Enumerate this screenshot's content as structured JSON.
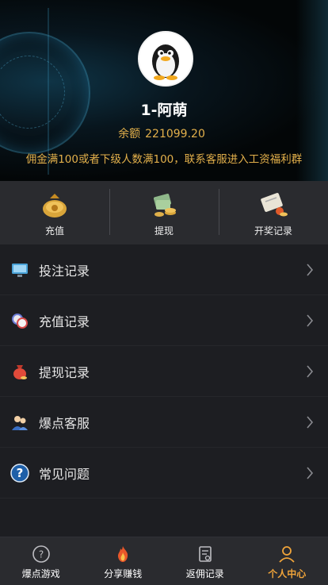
{
  "profile": {
    "username": "1-阿萌",
    "balance_label": "余额",
    "balance_value": "221099.20",
    "notice": "佣金满100或者下级人数满100，联系客服进入工资福利群"
  },
  "quick_actions": [
    {
      "label": "充值",
      "icon": "money-bag-icon"
    },
    {
      "label": "提现",
      "icon": "cash-coins-icon"
    },
    {
      "label": "开奖记录",
      "icon": "lottery-ticket-icon"
    }
  ],
  "menu": [
    {
      "label": "投注记录",
      "icon": "monitor-icon"
    },
    {
      "label": "充值记录",
      "icon": "poker-chips-icon"
    },
    {
      "label": "提现记录",
      "icon": "red-bag-icon"
    },
    {
      "label": "爆点客服",
      "icon": "support-agent-icon"
    },
    {
      "label": "常见问题",
      "icon": "question-icon"
    }
  ],
  "tabs": [
    {
      "label": "爆点游戏",
      "icon": "question-circle-icon",
      "active": false
    },
    {
      "label": "分享赚钱",
      "icon": "flame-icon",
      "active": false
    },
    {
      "label": "返佣记录",
      "icon": "receipt-icon",
      "active": false
    },
    {
      "label": "个人中心",
      "icon": "person-icon",
      "active": true
    }
  ],
  "colors": {
    "accent": "#f0a43a",
    "gold_text": "#e3b04b",
    "panel": "#2a2b2f",
    "background": "#1d1e22"
  }
}
